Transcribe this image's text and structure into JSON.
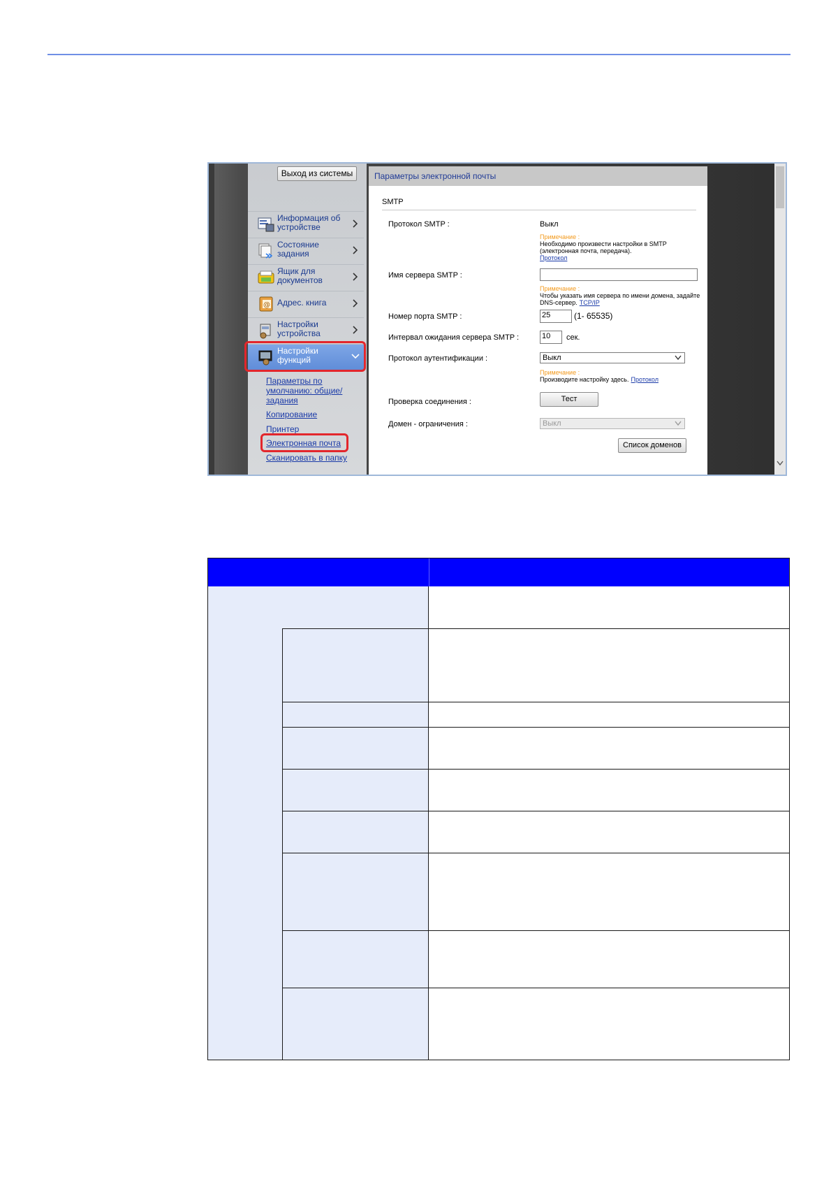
{
  "screenshot": {
    "logout_button": "Выход из системы",
    "panel_title": "Параметры электронной почты",
    "section_title": "SMTP",
    "menu": [
      {
        "label": "Информация об устройстве",
        "icon": "device-info-icon"
      },
      {
        "label": "Состояние задания",
        "icon": "job-status-icon"
      },
      {
        "label": "Ящик для документов",
        "icon": "document-box-icon"
      },
      {
        "label": "Адрес. книга",
        "icon": "address-book-icon"
      },
      {
        "label": "Настройки устройства",
        "icon": "device-settings-icon"
      },
      {
        "label": "Настройки функций",
        "icon": "function-settings-icon"
      }
    ],
    "submenu": {
      "defaults": "Параметры по умолчанию: общие/задания",
      "copy": "Копирование",
      "printer": "Принтер",
      "email": "Электронная почта",
      "scan_folder": "Сканировать в папку"
    },
    "fields": {
      "smtp_protocol_label": "Протокол SMTP :",
      "smtp_protocol_value": "Выкл",
      "note1_head": "Примечание :",
      "note1_text": "Необходимо произвести настройки в SMTP (электронная почта, передача).",
      "note1_link": "Протокол",
      "server_label": "Имя сервера SMTP :",
      "server_value": "",
      "note2_head": "Примечание :",
      "note2_text": "Чтобы указать имя сервера по имени домена, задайте DNS-сервер.",
      "note2_link": "TCP/IP",
      "port_label": "Номер порта SMTP :",
      "port_value": "25",
      "port_range": "(1- 65535)",
      "timeout_label": "Интервал ожидания сервера SMTP :",
      "timeout_value": "10",
      "timeout_unit": "сек.",
      "auth_label": "Протокол аутентификации :",
      "auth_value": "Выкл",
      "note3_head": "Примечание :",
      "note3_text": "Производите настройку здесь.",
      "note3_link": "Протокол",
      "test_label": "Проверка соединения :",
      "test_button": "Тест",
      "domain_label": "Домен - ограничения :",
      "domain_value": "Выкл",
      "domain_list_button": "Список доменов"
    }
  },
  "colors": {
    "rule": "#6f8fe6",
    "table_header": "#0000ff",
    "table_shade": "#e6ecfa",
    "highlight": "#e3262c",
    "note_orange": "#f39a1d"
  }
}
